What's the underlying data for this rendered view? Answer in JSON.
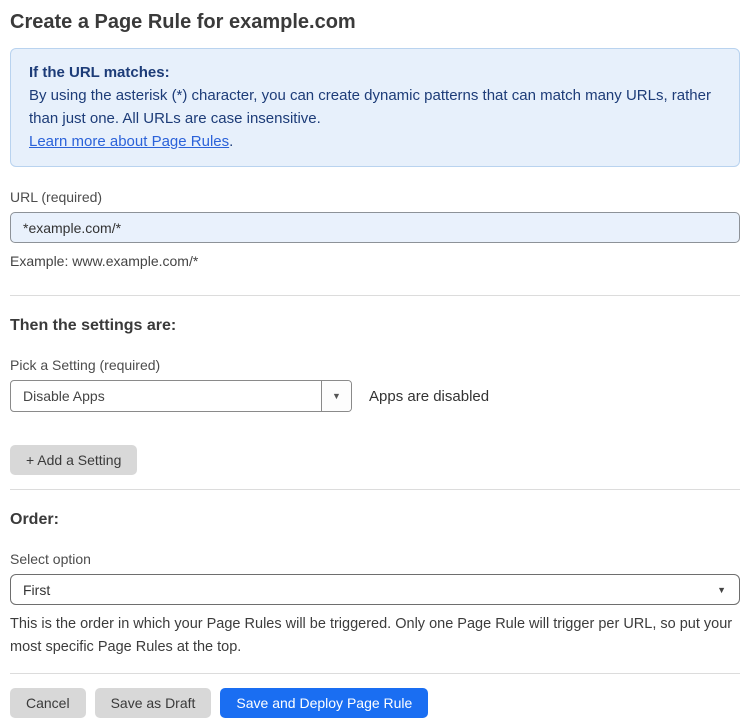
{
  "page": {
    "title": "Create a Page Rule for example.com"
  },
  "info_box": {
    "heading": "If the URL matches:",
    "body": "By using the asterisk (*) character, you can create dynamic patterns that can match many URLs, rather than just one. All URLs are case insensitive.",
    "link_label": "Learn more about Page Rules",
    "link_suffix": "."
  },
  "url_field": {
    "label": "URL (required)",
    "value": "*example.com/*",
    "helper": "Example: www.example.com/*"
  },
  "settings_section": {
    "heading": "Then the settings are:",
    "setting_label": "Pick a Setting (required)",
    "setting_value": "Disable Apps",
    "setting_status": "Apps are disabled",
    "add_setting_label": "+ Add a Setting",
    "dropdown_arrow": "▼"
  },
  "order_section": {
    "heading": "Order:",
    "select_label": "Select option",
    "select_value": "First",
    "select_arrow": "▼",
    "helper": "This is the order in which your Page Rules will be triggered. Only one Page Rule will trigger per URL, so put your most specific Page Rules at the top."
  },
  "actions": {
    "cancel_label": "Cancel",
    "save_draft_label": "Save as Draft",
    "save_deploy_label": "Save and Deploy Page Rule"
  },
  "colors": {
    "accent_blue": "#1a6ef2",
    "info_bg": "#e7f0fb",
    "info_border": "#b9d3ef",
    "info_text": "#1d3c78",
    "link_blue": "#2b62d9",
    "input_bg": "#e9f1fc",
    "button_gray": "#d8d8d8"
  }
}
